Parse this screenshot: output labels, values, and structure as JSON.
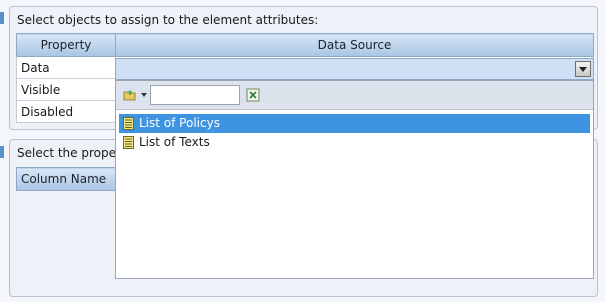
{
  "panel_top": {
    "title": "Select objects to assign to the element attributes:",
    "columns": [
      "Property",
      "Data Source"
    ],
    "rows": [
      {
        "property": "Data"
      },
      {
        "property": "Visible"
      },
      {
        "property": "Disabled"
      }
    ]
  },
  "panel_bottom": {
    "title": "Select the prope",
    "columns": [
      "Column Name"
    ]
  },
  "dropdown": {
    "search_value": "",
    "items": [
      {
        "label": "List of Policys",
        "selected": true,
        "icon": "list-icon"
      },
      {
        "label": "List of Texts",
        "selected": false,
        "icon": "list-icon"
      }
    ]
  },
  "colors": {
    "header": "#a9c4e2",
    "selected": "#3e94e0",
    "combo": "#cfe0f4"
  }
}
